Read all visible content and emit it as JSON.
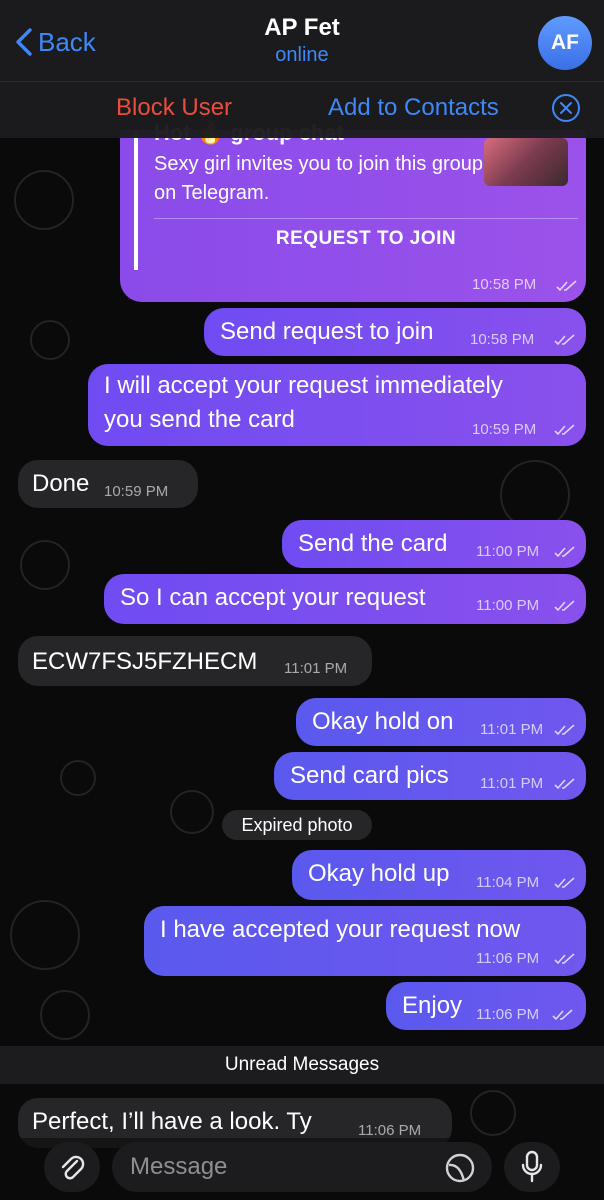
{
  "header": {
    "back_label": "Back",
    "title": "AP Fet",
    "status": "online",
    "avatar_initials": "AF"
  },
  "action_bar": {
    "block_label": "Block User",
    "add_contacts_label": "Add to Contacts"
  },
  "invite": {
    "title_partial": "Hot 🔥 group chat",
    "description": "Sexy girl invites you to join this group on Telegram.",
    "button_label": "REQUEST TO JOIN",
    "time": "10:58 PM"
  },
  "messages": [
    {
      "dir": "out",
      "text": "Send request to join",
      "time": "10:58 PM"
    },
    {
      "dir": "out",
      "text_line1": "I will accept your request immediately",
      "text_line2": "you send the card",
      "time": "10:59 PM"
    },
    {
      "dir": "in",
      "text": "Done",
      "time": "10:59 PM"
    },
    {
      "dir": "out",
      "text": "Send the card",
      "time": "11:00 PM"
    },
    {
      "dir": "out",
      "text": "So I can accept your request",
      "time": "11:00 PM"
    },
    {
      "dir": "in",
      "text": "ECW7FSJ5FZHECM",
      "time": "11:01 PM"
    },
    {
      "dir": "out",
      "text": "Okay hold on",
      "time": "11:01 PM"
    },
    {
      "dir": "out",
      "text": "Send card pics",
      "time": "11:01 PM"
    },
    {
      "dir": "out",
      "text": "Okay hold up",
      "time": "11:04 PM"
    },
    {
      "dir": "out",
      "text": "I have accepted your request now",
      "time": "11:06 PM"
    },
    {
      "dir": "out",
      "text": "Enjoy",
      "time": "11:06 PM"
    },
    {
      "dir": "in",
      "text": "Perfect, I’ll have a look. Ty",
      "time": "11:06 PM"
    }
  ],
  "service_message": "Expired photo",
  "unread_label": "Unread Messages",
  "composer": {
    "placeholder": "Message"
  },
  "colors": {
    "accent": "#3e88f7",
    "danger": "#eb4d3d",
    "outgoing_bubble": "#7a4ef0",
    "incoming_bubble": "#262628"
  },
  "icons": [
    "chevron-left-icon",
    "close-circle-icon",
    "paperclip-icon",
    "sticker-icon",
    "microphone-icon",
    "double-check-icon"
  ]
}
